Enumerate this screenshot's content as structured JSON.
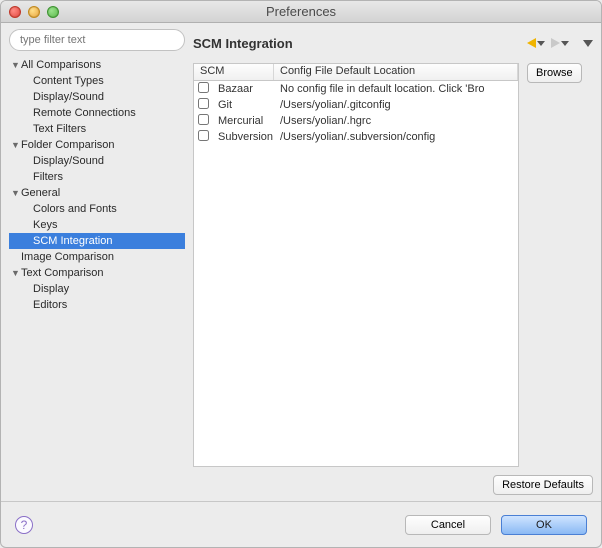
{
  "window": {
    "title": "Preferences"
  },
  "sidebar": {
    "filter_placeholder": "type filter text",
    "items": [
      {
        "label": "All Comparisons",
        "expandable": true,
        "indent": 0
      },
      {
        "label": "Content Types",
        "expandable": false,
        "indent": 1
      },
      {
        "label": "Display/Sound",
        "expandable": false,
        "indent": 1
      },
      {
        "label": "Remote Connections",
        "expandable": false,
        "indent": 1
      },
      {
        "label": "Text Filters",
        "expandable": false,
        "indent": 1
      },
      {
        "label": "Folder Comparison",
        "expandable": true,
        "indent": 0
      },
      {
        "label": "Display/Sound",
        "expandable": false,
        "indent": 1
      },
      {
        "label": "Filters",
        "expandable": false,
        "indent": 1
      },
      {
        "label": "General",
        "expandable": true,
        "indent": 0
      },
      {
        "label": "Colors and Fonts",
        "expandable": false,
        "indent": 1
      },
      {
        "label": "Keys",
        "expandable": false,
        "indent": 1
      },
      {
        "label": "SCM Integration",
        "expandable": false,
        "indent": 1,
        "selected": true
      },
      {
        "label": "Image Comparison",
        "expandable": false,
        "indent": 0
      },
      {
        "label": "Text Comparison",
        "expandable": true,
        "indent": 0
      },
      {
        "label": "Display",
        "expandable": false,
        "indent": 1
      },
      {
        "label": "Editors",
        "expandable": false,
        "indent": 1
      }
    ]
  },
  "main": {
    "title": "SCM Integration",
    "columns": {
      "scm": "SCM",
      "loc": "Config File Default Location"
    },
    "rows": [
      {
        "scm": "Bazaar",
        "loc": "No config file in default location. Click 'Bro"
      },
      {
        "scm": "Git",
        "loc": "/Users/yolian/.gitconfig"
      },
      {
        "scm": "Mercurial",
        "loc": "/Users/yolian/.hgrc"
      },
      {
        "scm": "Subversion",
        "loc": "/Users/yolian/.subversion/config"
      }
    ],
    "browse_label": "Browse",
    "restore_label": "Restore Defaults"
  },
  "footer": {
    "cancel": "Cancel",
    "ok": "OK"
  }
}
